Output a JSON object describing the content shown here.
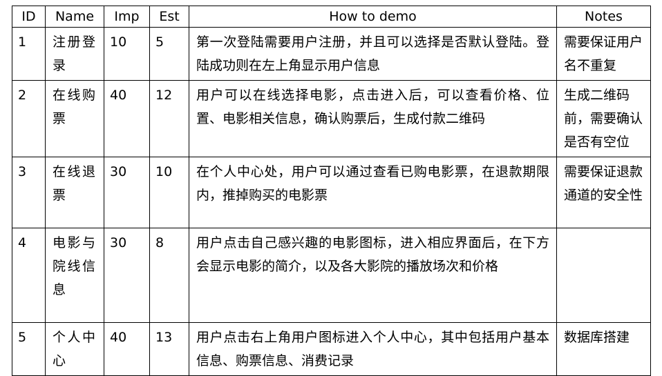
{
  "table": {
    "headers": {
      "id": "ID",
      "name": "Name",
      "imp": "Imp",
      "est": "Est",
      "demo": "How to demo",
      "notes": "Notes"
    },
    "rows": [
      {
        "id": "1",
        "name": "注册登录",
        "imp": "10",
        "est": "5",
        "demo": "第一次登陆需要用户注册，并且可以选择是否默认登陆。登陆成功则在左上角显示用户信息",
        "notes": "需要保证用户名不重复"
      },
      {
        "id": "2",
        "name": "在线购票",
        "imp": "40",
        "est": "12",
        "demo": "用户可以在线选择电影，点击进入后，可以查看价格、位置、电影相关信息，确认购票后，生成付款二维码",
        "notes": "生成二维码前，需要确认是否有空位"
      },
      {
        "id": "3",
        "name": "在线退票",
        "imp": "30",
        "est": "10",
        "demo": "在个人中心处，用户可以通过查看已购电影票，在退款期限内，推掉购买的电影票",
        "notes": "需要保证退款通道的安全性"
      },
      {
        "id": "4",
        "name": "电影与院线信息",
        "imp": "30",
        "est": "8",
        "demo": "用户点击自己感兴趣的电影图标，进入相应界面后，在下方会显示电影的简介，以及各大影院的播放场次和价格",
        "notes": ""
      },
      {
        "id": "5",
        "name": "个人中心",
        "imp": "40",
        "est": "13",
        "demo": "用户点击右上角用户图标进入个人中心，其中包括用户基本信息、购票信息、消费记录",
        "notes": "数据库搭建"
      }
    ]
  }
}
